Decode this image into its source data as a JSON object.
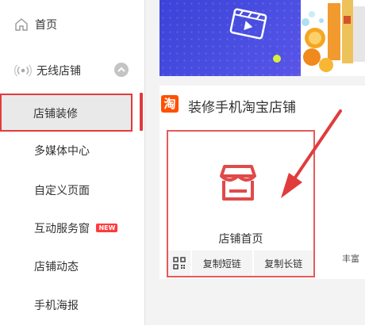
{
  "sidebar": {
    "home": {
      "label": "首页",
      "icon": "home-icon"
    },
    "store": {
      "label": "无线店铺",
      "icon": "wireless-icon"
    },
    "items": [
      {
        "label": "店铺装修"
      },
      {
        "label": "多媒体中心"
      },
      {
        "label": "自定义页面"
      },
      {
        "label": "互动服务窗",
        "badge": "NEW"
      },
      {
        "label": "店铺动态"
      },
      {
        "label": "手机海报"
      }
    ]
  },
  "main": {
    "section": {
      "logo": "淘",
      "title": "装修手机淘宝店铺"
    },
    "tile": {
      "label": "店铺首页",
      "actions": [
        "复制短链",
        "复制长链"
      ]
    },
    "right_snippet": "丰富"
  },
  "colors": {
    "accent_red": "#e03c3c",
    "taobao_orange": "#ff5000",
    "banner_blue": "#3d42d8"
  }
}
